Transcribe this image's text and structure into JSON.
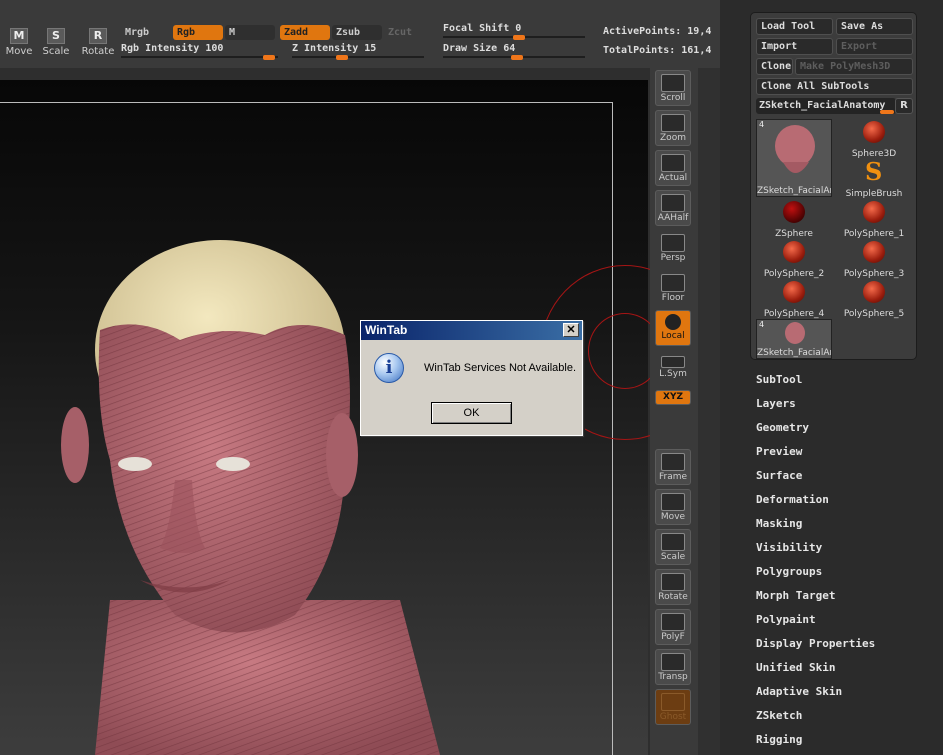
{
  "toolbar": {
    "move_label": "Move",
    "scale_label": "Scale",
    "rotate_label": "Rotate",
    "move_key": "M",
    "scale_key": "S",
    "rotate_key": "R",
    "mrgb": "Mrgb",
    "rgb": "Rgb",
    "m": "M",
    "rgb_intensity_label": "Rgb Intensity",
    "rgb_intensity_value": "100",
    "rgb_intensity_level": 1.0,
    "zadd": "Zadd",
    "zsub": "Zsub",
    "zcut": "Zcut",
    "z_intensity_label": "Z Intensity",
    "z_intensity_value": "15",
    "z_intensity_level": 0.15,
    "focal_shift_label": "Focal Shift",
    "focal_shift_value": "0",
    "draw_size_label": "Draw Size",
    "draw_size_value": "64",
    "active_points": "ActivePoints: 19,4",
    "total_points": "TotalPoints: 161,4"
  },
  "shelf": {
    "items": [
      {
        "label": "Scroll"
      },
      {
        "label": "Zoom"
      },
      {
        "label": "Actual"
      },
      {
        "label": "AAHalf"
      },
      {
        "label": "Persp"
      },
      {
        "label": "Floor"
      },
      {
        "label": "Local"
      },
      {
        "label": "L.Sym"
      },
      {
        "label": "XYZ"
      },
      {
        "label": "Frame"
      },
      {
        "label": "Move"
      },
      {
        "label": "Scale"
      },
      {
        "label": "Rotate"
      },
      {
        "label": "PolyF"
      },
      {
        "label": "Transp"
      },
      {
        "label": "Ghost"
      }
    ]
  },
  "tool_panel": {
    "load_tool": "Load Tool",
    "save_as": "Save As",
    "import": "Import",
    "export": "Export",
    "clone": "Clone",
    "make_polymesh": "Make PolyMesh3D",
    "clone_all": "Clone All SubTools",
    "current_tool": "ZSketch_FacialAnatomy",
    "r_button": "R",
    "tools": [
      {
        "label": "ZSketch_FacialAn",
        "count": "4"
      },
      {
        "label": "Sphere3D"
      },
      {
        "label": "SimpleBrush",
        "glyph": "S"
      },
      {
        "label": "ZSphere"
      },
      {
        "label": "PolySphere_1"
      },
      {
        "label": "PolySphere_2"
      },
      {
        "label": "PolySphere_3"
      },
      {
        "label": "PolySphere_4"
      },
      {
        "label": "PolySphere_5"
      },
      {
        "label": "ZSketch_FacialAn",
        "count": "4"
      }
    ],
    "menu": [
      "SubTool",
      "Layers",
      "Geometry",
      "Preview",
      "Surface",
      "Deformation",
      "Masking",
      "Visibility",
      "Polygroups",
      "Morph Target",
      "Polypaint",
      "Display Properties",
      "Unified Skin",
      "Adaptive Skin",
      "ZSketch",
      "Rigging"
    ]
  },
  "dialog": {
    "title": "WinTab",
    "message": "WinTab Services Not Available.",
    "ok": "OK",
    "close": "✕",
    "info_glyph": "i"
  },
  "colors": {
    "accent": "#e0760f",
    "skin": "#b96a73",
    "skull": "#e9dcae"
  }
}
